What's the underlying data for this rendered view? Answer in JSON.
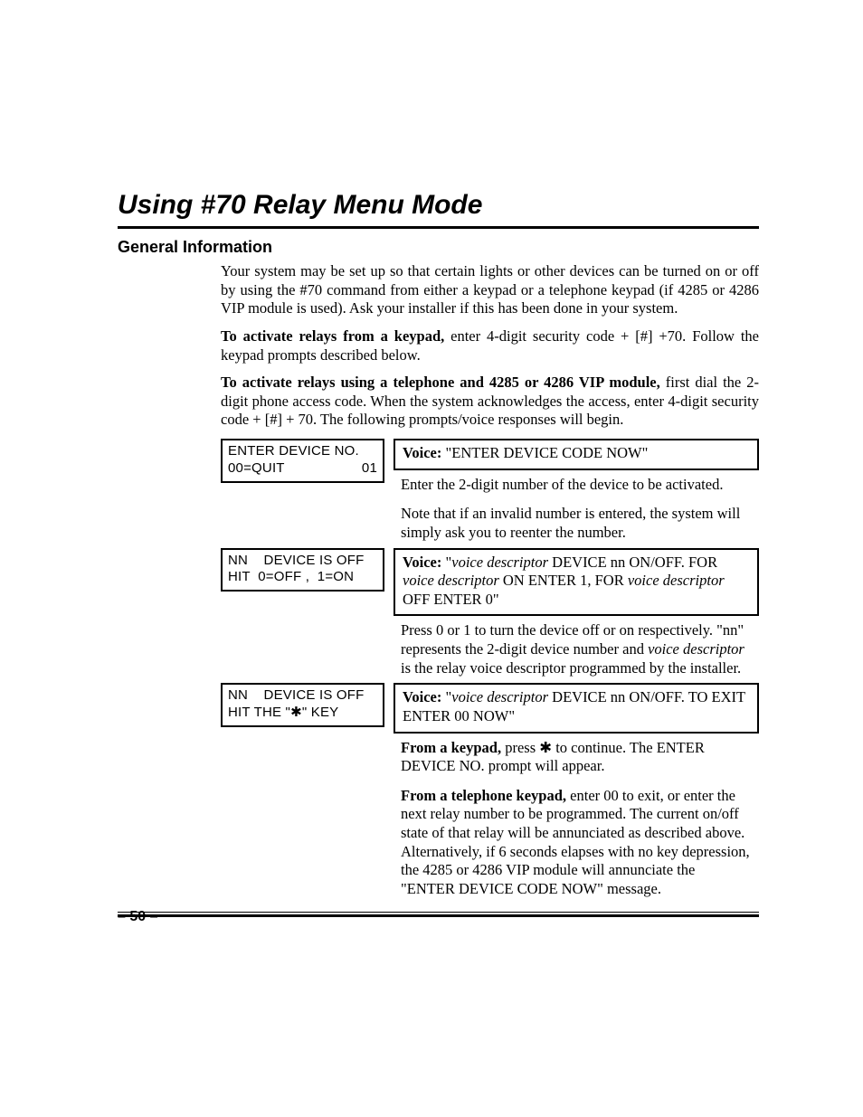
{
  "chapterTitle": "Using #70 Relay Menu Mode",
  "sectionTitle": "General Information",
  "para1": "Your system may be set up so that certain lights or other devices can be turned on or off by using the #70 command from either a keypad or a telephone keypad (if 4285 or 4286 VIP module is used). Ask your installer if this has been done in your system.",
  "para2_bold": "To activate relays from a keypad,",
  "para2_rest": " enter 4-digit security code + [#] +70. Follow the keypad prompts described below.",
  "para3_bold": "To activate relays using a telephone and 4285 or 4286 VIP module,",
  "para3_rest": " first dial the 2-digit phone access code. When the system acknowledges the access, enter 4-digit security code + [#] + 70. The following prompts/voice responses will begin.",
  "rows": [
    {
      "lcd_line1": "ENTER DEVICE NO.",
      "lcd_line2_left": "00=QUIT",
      "lcd_line2_right": "01",
      "voice_label": "Voice:",
      "voice_text": " \"ENTER DEVICE CODE NOW\"",
      "desc1": "Enter the 2-digit number of the device to be activated.",
      "desc2": "Note that if an invalid number is entered, the system will simply ask you to reenter the number."
    },
    {
      "lcd_line1": "NN    DEVICE IS OFF",
      "lcd_line2_left": "HIT  0=OFF ,  1=ON",
      "lcd_line2_right": "",
      "voice_label": "Voice:",
      "voice_italic_a": "voice descriptor",
      "voice_mid1": "  DEVICE nn ON/OFF. FOR ",
      "voice_italic_b": "voice descriptor",
      "voice_mid2": " ON ENTER 1, FOR ",
      "voice_italic_c": "voice descriptor",
      "voice_end": " OFF ENTER 0\"",
      "desc1a": "Press 0 or 1 to turn the device off or on respectively. \"nn\" represents the 2-digit device number and ",
      "desc1_italic": "voice descriptor",
      "desc1b": " is the relay voice descriptor programmed by the installer."
    },
    {
      "lcd_line1": "NN    DEVICE IS OFF",
      "lcd_line2_left": "HIT THE \"✱\" KEY",
      "lcd_line2_right": "",
      "voice_label": "Voice:",
      "voice_italic_a": "voice descriptor",
      "voice_mid1": "  DEVICE nn ON/OFF.  TO EXIT ENTER 00 NOW\"",
      "desc1_bold": "From a keypad,",
      "desc1_rest": " press ✱ to continue. The ENTER DEVICE NO. prompt will appear.",
      "desc2_bold": "From a telephone keypad,",
      "desc2_rest": " enter 00 to exit, or enter the next relay number to be programmed. The current on/off state of that relay will be annunciated as described above. Alternatively, if 6 seconds elapses with no key depression, the 4285 or 4286 VIP module will annunciate the \"ENTER DEVICE CODE NOW\" message."
    }
  ],
  "pageNumber": "– 50 –"
}
